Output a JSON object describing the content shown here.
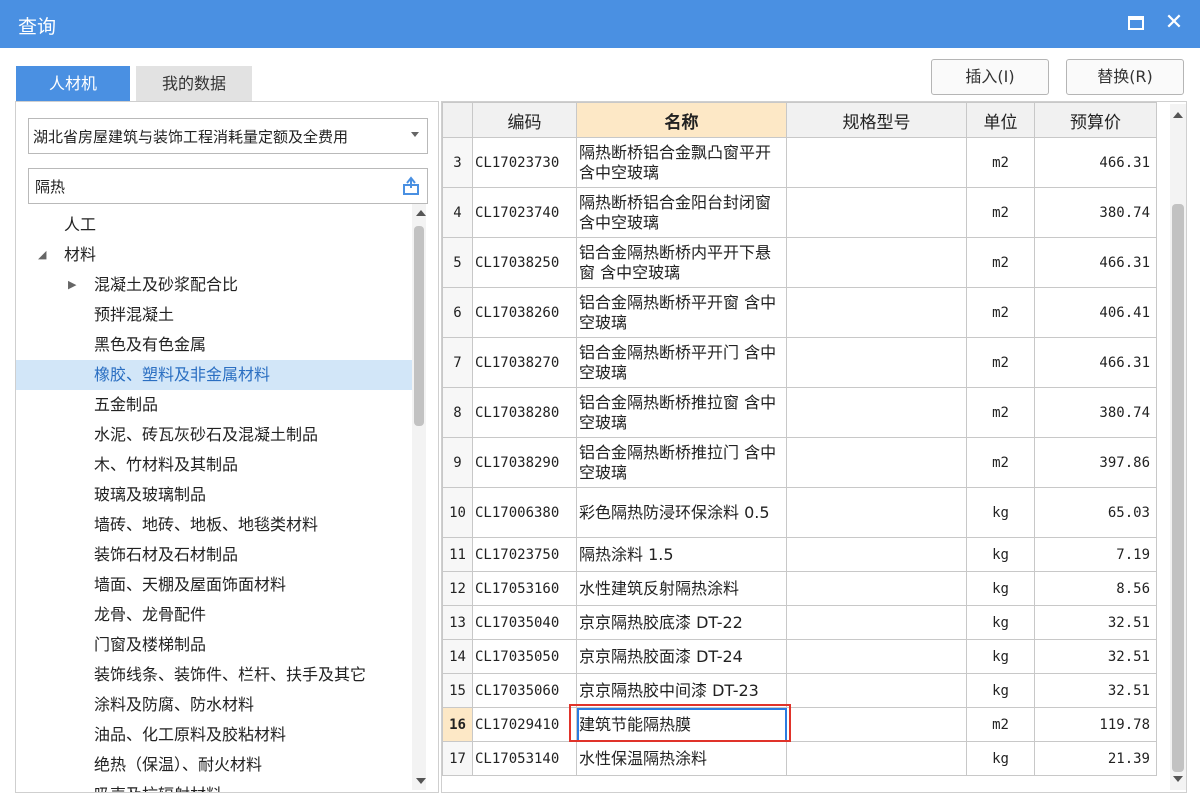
{
  "window": {
    "title": "查询"
  },
  "tabs": [
    {
      "label": "人材机",
      "active": true
    },
    {
      "label": "我的数据",
      "active": false
    }
  ],
  "buttons": {
    "insert": "插入(I)",
    "replace": "替换(R)"
  },
  "left": {
    "dropdown_value": "湖北省房屋建筑与装饰工程消耗量定额及全费用",
    "search_value": "隔热",
    "tree": [
      {
        "label": "人工",
        "level": 0,
        "arrow": ""
      },
      {
        "label": "材料",
        "level": 0,
        "arrow": "◢"
      },
      {
        "label": "混凝土及砂浆配合比",
        "level": 1,
        "arrow": "▶"
      },
      {
        "label": "预拌混凝土",
        "level": 1,
        "arrow": ""
      },
      {
        "label": "黑色及有色金属",
        "level": 1,
        "arrow": ""
      },
      {
        "label": "橡胶、塑料及非金属材料",
        "level": 1,
        "arrow": "",
        "selected": true
      },
      {
        "label": "五金制品",
        "level": 1,
        "arrow": ""
      },
      {
        "label": "水泥、砖瓦灰砂石及混凝土制品",
        "level": 1,
        "arrow": ""
      },
      {
        "label": "木、竹材料及其制品",
        "level": 1,
        "arrow": ""
      },
      {
        "label": "玻璃及玻璃制品",
        "level": 1,
        "arrow": ""
      },
      {
        "label": "墙砖、地砖、地板、地毯类材料",
        "level": 1,
        "arrow": ""
      },
      {
        "label": "装饰石材及石材制品",
        "level": 1,
        "arrow": ""
      },
      {
        "label": "墙面、天棚及屋面饰面材料",
        "level": 1,
        "arrow": ""
      },
      {
        "label": "龙骨、龙骨配件",
        "level": 1,
        "arrow": ""
      },
      {
        "label": "门窗及楼梯制品",
        "level": 1,
        "arrow": ""
      },
      {
        "label": "装饰线条、装饰件、栏杆、扶手及其它",
        "level": 1,
        "arrow": ""
      },
      {
        "label": "涂料及防腐、防水材料",
        "level": 1,
        "arrow": ""
      },
      {
        "label": "油品、化工原料及胶粘材料",
        "level": 1,
        "arrow": ""
      },
      {
        "label": "绝热（保温）、耐火材料",
        "level": 1,
        "arrow": ""
      },
      {
        "label": "吸声及抗辐射材料",
        "level": 1,
        "arrow": ""
      }
    ]
  },
  "table": {
    "headers": {
      "num": "",
      "code": "编码",
      "name": "名称",
      "spec": "规格型号",
      "unit": "单位",
      "price": "预算价"
    },
    "rows": [
      {
        "num": "3",
        "code": "CL17023730",
        "name": "隔热断桥铝合金飘凸窗平开 含中空玻璃",
        "spec": "",
        "unit": "m2",
        "price": "466.31"
      },
      {
        "num": "4",
        "code": "CL17023740",
        "name": "隔热断桥铝合金阳台封闭窗 含中空玻璃",
        "spec": "",
        "unit": "m2",
        "price": "380.74"
      },
      {
        "num": "5",
        "code": "CL17038250",
        "name": "铝合金隔热断桥内平开下悬窗 含中空玻璃",
        "spec": "",
        "unit": "m2",
        "price": "466.31"
      },
      {
        "num": "6",
        "code": "CL17038260",
        "name": "铝合金隔热断桥平开窗 含中空玻璃",
        "spec": "",
        "unit": "m2",
        "price": "406.41"
      },
      {
        "num": "7",
        "code": "CL17038270",
        "name": "铝合金隔热断桥平开门 含中空玻璃",
        "spec": "",
        "unit": "m2",
        "price": "466.31"
      },
      {
        "num": "8",
        "code": "CL17038280",
        "name": "铝合金隔热断桥推拉窗 含中空玻璃",
        "spec": "",
        "unit": "m2",
        "price": "380.74"
      },
      {
        "num": "9",
        "code": "CL17038290",
        "name": "铝合金隔热断桥推拉门 含中空玻璃",
        "spec": "",
        "unit": "m2",
        "price": "397.86"
      },
      {
        "num": "10",
        "code": "CL17006380",
        "name": "彩色隔热防浸环保涂料 0.5",
        "spec": "",
        "unit": "kg",
        "price": "65.03"
      },
      {
        "num": "11",
        "code": "CL17023750",
        "name": "隔热涂料 1.5",
        "spec": "",
        "unit": "kg",
        "price": "7.19"
      },
      {
        "num": "12",
        "code": "CL17053160",
        "name": "水性建筑反射隔热涂料",
        "spec": "",
        "unit": "kg",
        "price": "8.56"
      },
      {
        "num": "13",
        "code": "CL17035040",
        "name": "京京隔热胶底漆 DT-22",
        "spec": "",
        "unit": "kg",
        "price": "32.51"
      },
      {
        "num": "14",
        "code": "CL17035050",
        "name": "京京隔热胶面漆 DT-24",
        "spec": "",
        "unit": "kg",
        "price": "32.51"
      },
      {
        "num": "15",
        "code": "CL17035060",
        "name": "京京隔热胶中间漆 DT-23",
        "spec": "",
        "unit": "kg",
        "price": "32.51"
      },
      {
        "num": "16",
        "code": "CL17029410",
        "name": "建筑节能隔热膜",
        "spec": "",
        "unit": "m2",
        "price": "119.78",
        "selected": true
      },
      {
        "num": "17",
        "code": "CL17053140",
        "name": "水性保温隔热涂料",
        "spec": "",
        "unit": "kg",
        "price": "21.39"
      }
    ]
  },
  "colors": {
    "titlebar": "#4a90e2",
    "selection_bg": "#d2e6f8",
    "name_header": "#fde8c6",
    "highlight_border": "#e0332a"
  }
}
